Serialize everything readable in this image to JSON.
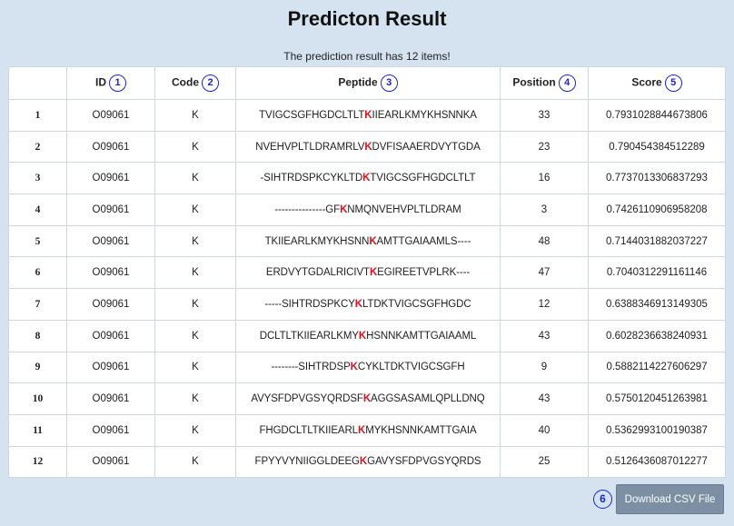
{
  "page": {
    "title": "Predicton Result",
    "subtitle": "The prediction result has 12 items!"
  },
  "table": {
    "headers": [
      "",
      "ID",
      "Code",
      "Peptide",
      "Position",
      "Score"
    ],
    "badges": [
      "1",
      "2",
      "3",
      "4",
      "5"
    ],
    "rows": [
      {
        "idx": "1",
        "id": "O09061",
        "code": "K",
        "peptide_pre": "TVIGCSGFHGDCLTLT",
        "peptide_k": "K",
        "peptide_post": "IIEARLKMYKHSNNKA",
        "position": "33",
        "score": "0.7931028844673806"
      },
      {
        "idx": "2",
        "id": "O09061",
        "code": "K",
        "peptide_pre": "NVEHVPLTLDRAMRLV",
        "peptide_k": "K",
        "peptide_post": "DVFISAAERDVYTGDA",
        "position": "23",
        "score": "0.790454384512289"
      },
      {
        "idx": "3",
        "id": "O09061",
        "code": "K",
        "peptide_pre": "-SIHTRDSPKCYKLTD",
        "peptide_k": "K",
        "peptide_post": "TVIGCSGFHGDCLTLT",
        "position": "16",
        "score": "0.7737013306837293"
      },
      {
        "idx": "4",
        "id": "O09061",
        "code": "K",
        "peptide_pre": "---------------GF",
        "peptide_k": "K",
        "peptide_post": "NMQNVEHVPLTLDRAM",
        "position": "3",
        "score": "0.7426110906958208"
      },
      {
        "idx": "5",
        "id": "O09061",
        "code": "K",
        "peptide_pre": "TKIIEARLKMYKHSNN",
        "peptide_k": "K",
        "peptide_post": "AMTTGAIAAMLS----",
        "position": "48",
        "score": "0.7144031882037227"
      },
      {
        "idx": "6",
        "id": "O09061",
        "code": "K",
        "peptide_pre": "ERDVYTGDALRICIVT",
        "peptide_k": "K",
        "peptide_post": "EGIREETVPLRK----",
        "position": "47",
        "score": "0.7040312291161146"
      },
      {
        "idx": "7",
        "id": "O09061",
        "code": "K",
        "peptide_pre": "-----SIHTRDSPKCY",
        "peptide_k": "K",
        "peptide_post": "LTDKTVIGCSGFHGDC",
        "position": "12",
        "score": "0.6388346913149305"
      },
      {
        "idx": "8",
        "id": "O09061",
        "code": "K",
        "peptide_pre": "DCLTLTKIIEARLKMY",
        "peptide_k": "K",
        "peptide_post": "HSNNKAMTTGAIAAML",
        "position": "43",
        "score": "0.6028236638240931"
      },
      {
        "idx": "9",
        "id": "O09061",
        "code": "K",
        "peptide_pre": "--------SIHTRDSP",
        "peptide_k": "K",
        "peptide_post": "CYKLTDKTVIGCSGFH",
        "position": "9",
        "score": "0.5882114227606297"
      },
      {
        "idx": "10",
        "id": "O09061",
        "code": "K",
        "peptide_pre": "AVYSFDPVGSYQRDSF",
        "peptide_k": "K",
        "peptide_post": "AGGSASAMLQPLLDNQ",
        "position": "43",
        "score": "0.5750120451263981"
      },
      {
        "idx": "11",
        "id": "O09061",
        "code": "K",
        "peptide_pre": "FHGDCLTLTKIIEARL",
        "peptide_k": "K",
        "peptide_post": "MYKHSNNKAMTTGAIA",
        "position": "40",
        "score": "0.5362993100190387"
      },
      {
        "idx": "12",
        "id": "O09061",
        "code": "K",
        "peptide_pre": "FPYYVYNIIGGLDEEG",
        "peptide_k": "K",
        "peptide_post": "GAVYSFDPVGSYQRDS",
        "position": "25",
        "score": "0.5126436087012277"
      }
    ]
  },
  "download": {
    "badge": "6",
    "label": "Download CSV File"
  },
  "colors": {
    "background": "#d5e3f0",
    "badge": "#1a23d6",
    "highlight": "#e0101e",
    "button": "#7d8fa3"
  }
}
